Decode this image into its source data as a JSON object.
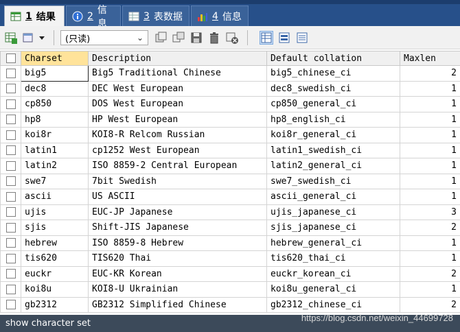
{
  "tabs": [
    {
      "num": "1",
      "label": "结果",
      "active": true
    },
    {
      "num": "2",
      "label": "信息",
      "active": false
    },
    {
      "num": "3",
      "label": "表数据",
      "active": false
    },
    {
      "num": "4",
      "label": "信息",
      "active": false
    }
  ],
  "toolbar": {
    "readonly_label": "(只读)"
  },
  "table": {
    "columns": [
      "Charset",
      "Description",
      "Default collation",
      "Maxlen"
    ],
    "rows": [
      [
        "big5",
        "Big5 Traditional Chinese",
        "big5_chinese_ci",
        "2"
      ],
      [
        "dec8",
        "DEC West European",
        "dec8_swedish_ci",
        "1"
      ],
      [
        "cp850",
        "DOS West European",
        "cp850_general_ci",
        "1"
      ],
      [
        "hp8",
        "HP West European",
        "hp8_english_ci",
        "1"
      ],
      [
        "koi8r",
        "KOI8-R Relcom Russian",
        "koi8r_general_ci",
        "1"
      ],
      [
        "latin1",
        "cp1252 West European",
        "latin1_swedish_ci",
        "1"
      ],
      [
        "latin2",
        "ISO 8859-2 Central European",
        "latin2_general_ci",
        "1"
      ],
      [
        "swe7",
        "7bit Swedish",
        "swe7_swedish_ci",
        "1"
      ],
      [
        "ascii",
        "US ASCII",
        "ascii_general_ci",
        "1"
      ],
      [
        "ujis",
        "EUC-JP Japanese",
        "ujis_japanese_ci",
        "3"
      ],
      [
        "sjis",
        "Shift-JIS Japanese",
        "sjis_japanese_ci",
        "2"
      ],
      [
        "hebrew",
        "ISO 8859-8 Hebrew",
        "hebrew_general_ci",
        "1"
      ],
      [
        "tis620",
        "TIS620 Thai",
        "tis620_thai_ci",
        "1"
      ],
      [
        "euckr",
        "EUC-KR Korean",
        "euckr_korean_ci",
        "2"
      ],
      [
        "koi8u",
        "KOI8-U Ukrainian",
        "koi8u_general_ci",
        "1"
      ],
      [
        "gb2312",
        "GB2312 Simplified Chinese",
        "gb2312_chinese_ci",
        "2"
      ]
    ]
  },
  "status": {
    "text": "show character set"
  },
  "watermark": "https://blog.csdn.net/weixin_44699728"
}
